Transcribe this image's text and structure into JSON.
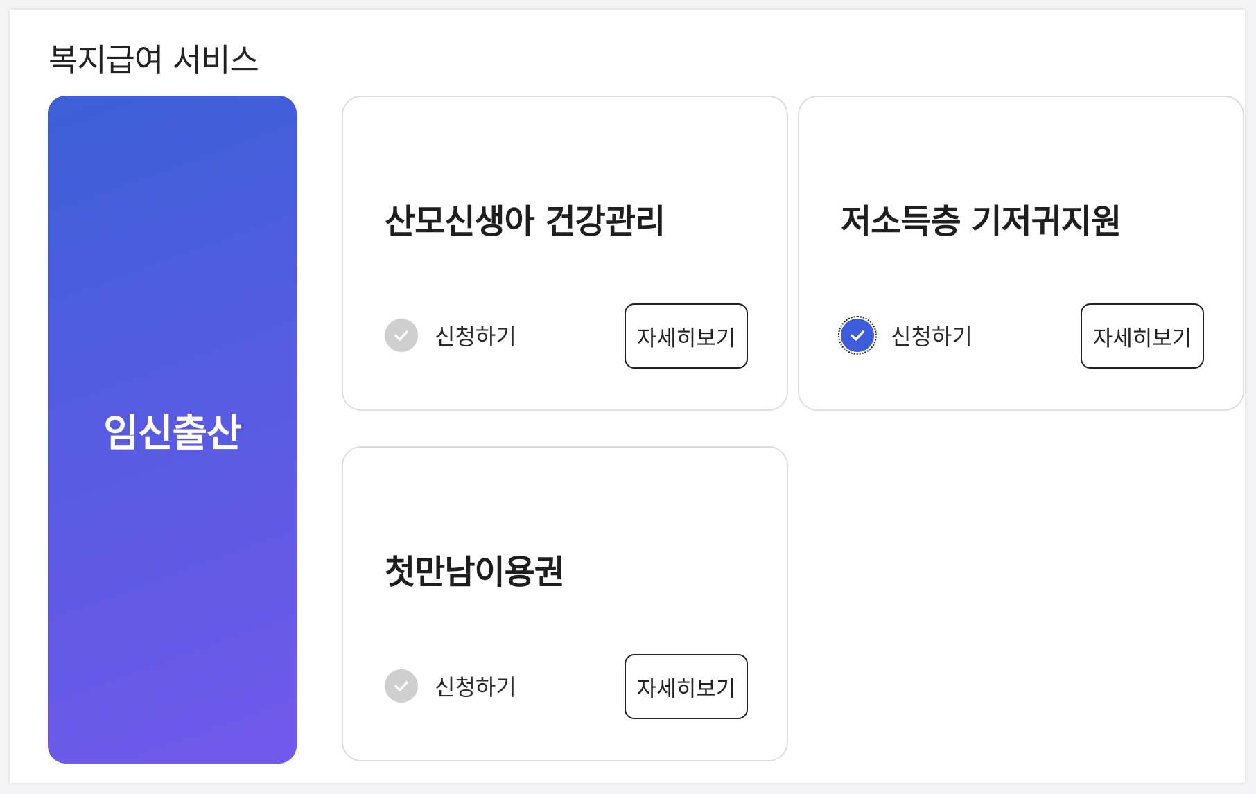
{
  "section": {
    "title": "복지급여 서비스"
  },
  "category": {
    "label": "임신출산"
  },
  "services": [
    {
      "name": "산모신생아 건강관리",
      "apply_label": "신청하기",
      "apply_checked": false,
      "detail_label": "자세히보기"
    },
    {
      "name": "저소득층 기저귀지원",
      "apply_label": "신청하기",
      "apply_checked": true,
      "detail_label": "자세히보기"
    },
    {
      "name": "첫만남이용권",
      "apply_label": "신청하기",
      "apply_checked": false,
      "detail_label": "자세히보기"
    }
  ],
  "colors": {
    "accent": "#3e5ddc",
    "unchecked": "#cfcfcf",
    "gradient_start": "#3c5fd7",
    "gradient_end": "#7359ec"
  }
}
